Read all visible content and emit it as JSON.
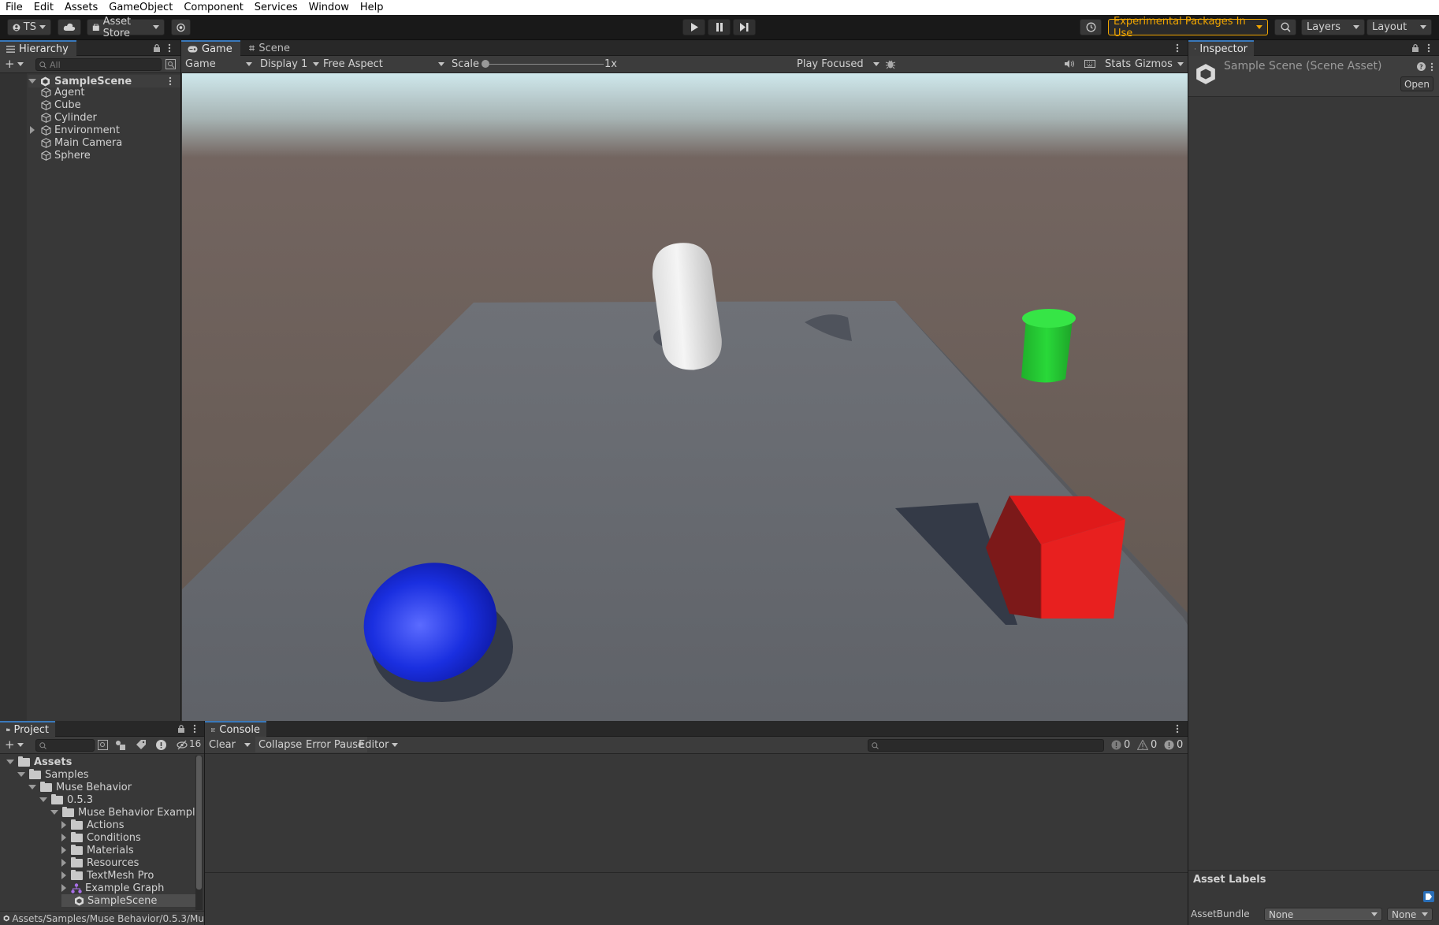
{
  "menu": [
    "File",
    "Edit",
    "Assets",
    "GameObject",
    "Component",
    "Services",
    "Window",
    "Help"
  ],
  "toolbar": {
    "account_label": "TS",
    "asset_store_label": "Asset Store",
    "experimental_label": "Experimental Packages In Use",
    "layers_label": "Layers",
    "layout_label": "Layout"
  },
  "hierarchy": {
    "tab_label": "Hierarchy",
    "search_placeholder": "All",
    "scene_name": "SampleScene",
    "items": [
      "Agent",
      "Cube",
      "Cylinder",
      "Environment",
      "Main Camera",
      "Sphere"
    ]
  },
  "game": {
    "tabs": [
      "Game",
      "Scene"
    ],
    "view_label": "Game",
    "display_label": "Display 1",
    "aspect_label": "Free Aspect",
    "scale_label": "Scale",
    "scale_value": "1x",
    "play_mode_label": "Play Focused",
    "stats_label": "Stats",
    "gizmos_label": "Gizmos"
  },
  "inspector": {
    "tab_label": "Inspector",
    "title": "Sample Scene (Scene Asset)",
    "open_label": "Open",
    "asset_labels_title": "Asset Labels",
    "assetbundle_label": "AssetBundle",
    "assetbundle_value": "None",
    "variant_value": "None"
  },
  "project": {
    "tab_label": "Project",
    "hidden_count": "16",
    "tree": [
      {
        "label": "Assets",
        "depth": 0,
        "kind": "open-folder"
      },
      {
        "label": "Samples",
        "depth": 1,
        "kind": "open-folder"
      },
      {
        "label": "Muse Behavior",
        "depth": 2,
        "kind": "open-folder"
      },
      {
        "label": "0.5.3",
        "depth": 3,
        "kind": "open-folder"
      },
      {
        "label": "Muse Behavior Example",
        "depth": 4,
        "kind": "open-folder"
      },
      {
        "label": "Actions",
        "depth": 5,
        "kind": "folder"
      },
      {
        "label": "Conditions",
        "depth": 5,
        "kind": "folder"
      },
      {
        "label": "Materials",
        "depth": 5,
        "kind": "folder"
      },
      {
        "label": "Resources",
        "depth": 5,
        "kind": "folder"
      },
      {
        "label": "TextMesh Pro",
        "depth": 5,
        "kind": "folder"
      },
      {
        "label": "Example Graph",
        "depth": 5,
        "kind": "graph"
      },
      {
        "label": "SampleScene",
        "depth": 5,
        "kind": "scene"
      }
    ],
    "path": "Assets/Samples/Muse Behavior/0.5.3/Mu"
  },
  "console": {
    "tab_label": "Console",
    "clear_label": "Clear",
    "collapse_label": "Collapse",
    "error_pause_label": "Error Pause",
    "editor_label": "Editor",
    "info_count": "0",
    "warning_count": "0",
    "error_count": "0"
  },
  "colors": {
    "accent": "#3a79bb",
    "experimental": "#f0a500",
    "sphere": "#1a2fe0",
    "cube": "#e01a1a",
    "cylinder": "#22d832",
    "capsule": "#e8e8e8"
  }
}
